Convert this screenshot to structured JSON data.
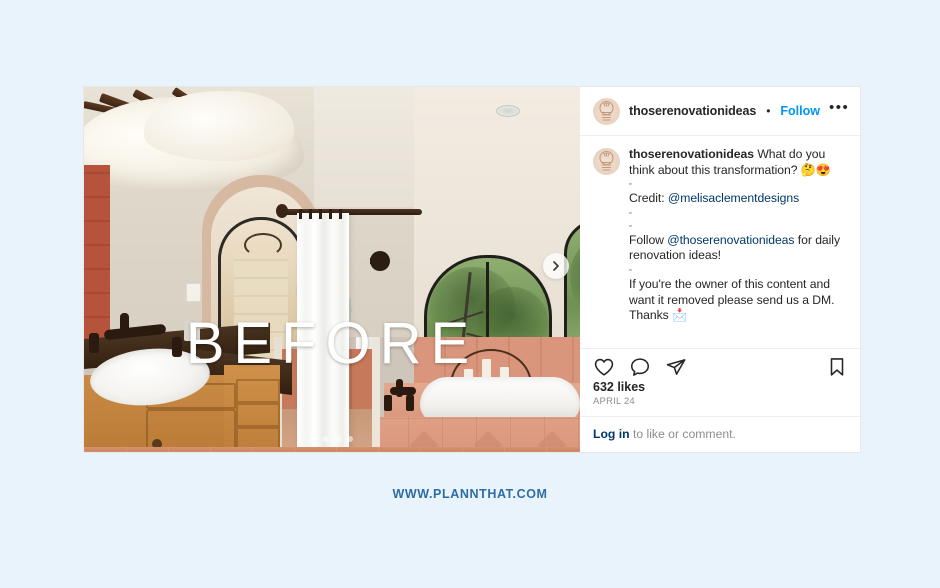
{
  "background_color": "#e8f3fc",
  "post": {
    "image_overlay_text": "BEFORE",
    "next_arrow_icon": "chevron-right-icon",
    "carousel": {
      "total": 4,
      "active_index": 0
    },
    "photo_alt": "before photo of a spanish style bathroom with oak vanity, white oval tub and terracotta tile"
  },
  "header": {
    "avatar_icon": "account-avatar-icon",
    "username": "thoserenovationideas",
    "separator": "•",
    "follow_label": "Follow",
    "more_options_icon": "ellipsis-icon",
    "more_options_label": "•••"
  },
  "caption": {
    "avatar_icon": "account-avatar-icon",
    "username": "thoserenovationideas",
    "line1": " What do you think about this transformation? 🤔😍",
    "blank_char": "▫",
    "credit_label": "Credit: ",
    "credit_handle": "@melisaclementdesigns",
    "follow_prefix": "Follow ",
    "follow_handle": "@thoserenovationideas",
    "follow_suffix": " for daily renovation ideas!",
    "removal_notice": "If you're the owner of this content and want it removed please send us a DM. Thanks 📩"
  },
  "actions": {
    "like_icon": "heart-icon",
    "comment_icon": "comment-bubble-icon",
    "share_icon": "share-paper-plane-icon",
    "save_icon": "bookmark-icon"
  },
  "stats": {
    "likes": "632 likes",
    "date": "APRIL 24"
  },
  "login_prompt": {
    "link_label": "Log in",
    "rest": " to like or comment."
  },
  "footer": {
    "url": "WWW.PLANNTHAT.COM",
    "color": "#2e6da4"
  },
  "colors": {
    "instagram_blue": "#0095f6",
    "link_navy": "#00376b",
    "text": "#262626",
    "muted": "#8e8e8e",
    "border": "#efefef"
  }
}
